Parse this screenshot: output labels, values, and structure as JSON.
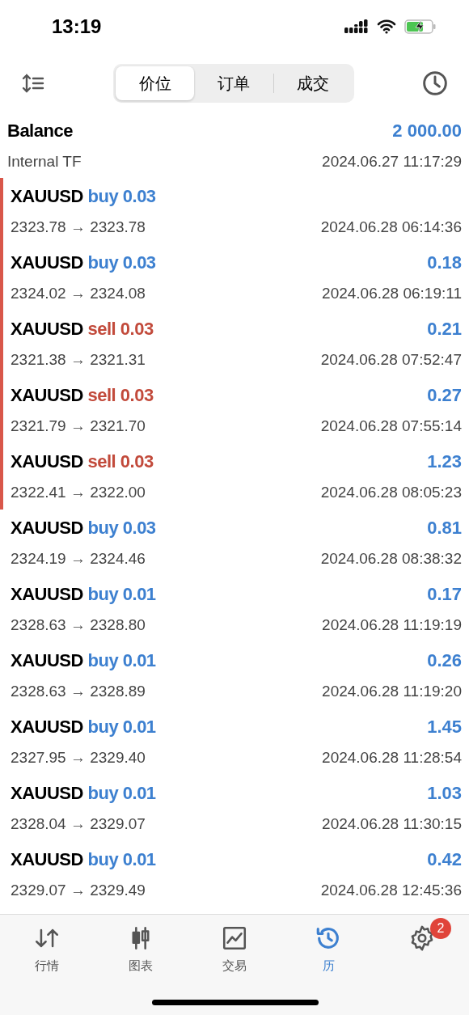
{
  "status_bar": {
    "time": "13:19"
  },
  "toolbar": {
    "tabs": [
      {
        "label": "价位",
        "selected": true
      },
      {
        "label": "订单",
        "selected": false
      },
      {
        "label": "成交",
        "selected": false
      }
    ]
  },
  "balance": {
    "title": "Balance",
    "amount": "2 000.00",
    "comment": "Internal TF",
    "time": "2024.06.27 11:17:29"
  },
  "deals": [
    {
      "symbol": "XAUUSD",
      "side": "buy",
      "volume": "0.03",
      "prices": "2323.78 → 2323.78",
      "time": "2024.06.28 06:14:36",
      "highlighted": true
    },
    {
      "symbol": "XAUUSD",
      "side": "buy",
      "volume": "0.03",
      "profit": "0.18",
      "prices": "2324.02 → 2324.08",
      "time": "2024.06.28 06:19:11",
      "highlighted": true
    },
    {
      "symbol": "XAUUSD",
      "side": "sell",
      "volume": "0.03",
      "profit": "0.21",
      "prices": "2321.38 → 2321.31",
      "time": "2024.06.28 07:52:47",
      "highlighted": true
    },
    {
      "symbol": "XAUUSD",
      "side": "sell",
      "volume": "0.03",
      "profit": "0.27",
      "prices": "2321.79 → 2321.70",
      "time": "2024.06.28 07:55:14",
      "highlighted": true
    },
    {
      "symbol": "XAUUSD",
      "side": "sell",
      "volume": "0.03",
      "profit": "1.23",
      "prices": "2322.41 → 2322.00",
      "time": "2024.06.28 08:05:23",
      "highlighted": true
    },
    {
      "symbol": "XAUUSD",
      "side": "buy",
      "volume": "0.03",
      "profit": "0.81",
      "prices": "2324.19 → 2324.46",
      "time": "2024.06.28 08:38:32",
      "highlighted": false
    },
    {
      "symbol": "XAUUSD",
      "side": "buy",
      "volume": "0.01",
      "profit": "0.17",
      "prices": "2328.63 → 2328.80",
      "time": "2024.06.28 11:19:19",
      "highlighted": false
    },
    {
      "symbol": "XAUUSD",
      "side": "buy",
      "volume": "0.01",
      "profit": "0.26",
      "prices": "2328.63 → 2328.89",
      "time": "2024.06.28 11:19:20",
      "highlighted": false
    },
    {
      "symbol": "XAUUSD",
      "side": "buy",
      "volume": "0.01",
      "profit": "1.45",
      "prices": "2327.95 → 2329.40",
      "time": "2024.06.28 11:28:54",
      "highlighted": false
    },
    {
      "symbol": "XAUUSD",
      "side": "buy",
      "volume": "0.01",
      "profit": "1.03",
      "prices": "2328.04 → 2329.07",
      "time": "2024.06.28 11:30:15",
      "highlighted": false
    },
    {
      "symbol": "XAUUSD",
      "side": "buy",
      "volume": "0.01",
      "profit": "0.42",
      "prices": "2329.07 → 2329.49",
      "time": "2024.06.28 12:45:36",
      "highlighted": false
    }
  ],
  "tab_bar": [
    {
      "kind": "quotes",
      "label": "行情",
      "selected": false
    },
    {
      "kind": "chart",
      "label": "图表",
      "selected": false
    },
    {
      "kind": "trade",
      "label": "交易",
      "selected": false
    },
    {
      "kind": "history",
      "label": "历",
      "selected": true
    },
    {
      "kind": "settings",
      "badge": "2",
      "selected": false
    }
  ]
}
